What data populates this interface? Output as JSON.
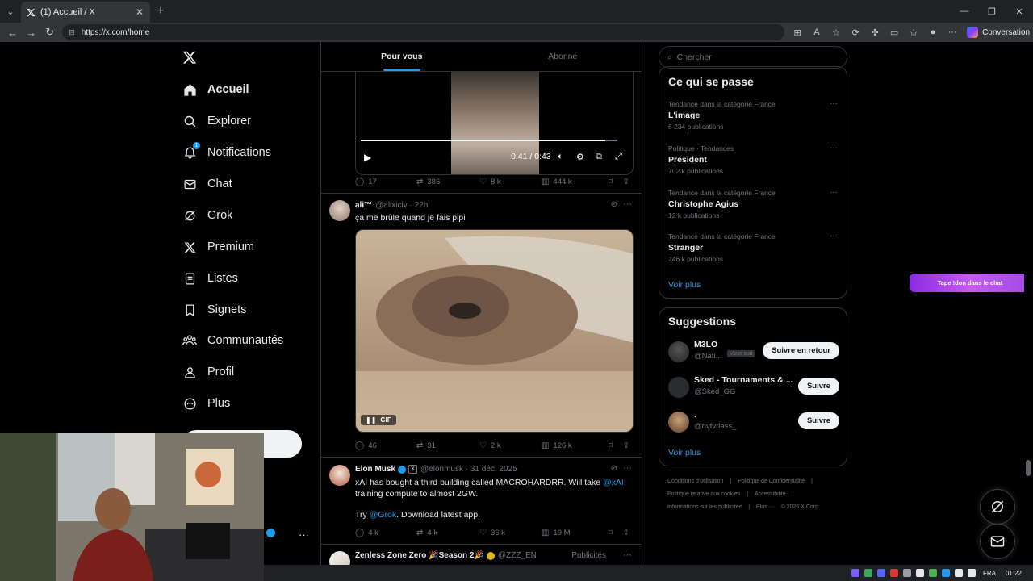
{
  "browser": {
    "tab_title": "(1) Accueil / X",
    "url": "https://x.com/home",
    "conversation_label": "Conversation"
  },
  "nav": {
    "items": [
      {
        "label": "Accueil",
        "icon": "home-icon"
      },
      {
        "label": "Explorer",
        "icon": "search-icon"
      },
      {
        "label": "Notifications",
        "icon": "bell-icon",
        "badge": "1"
      },
      {
        "label": "Chat",
        "icon": "mail-icon"
      },
      {
        "label": "Grok",
        "icon": "grok-icon"
      },
      {
        "label": "Premium",
        "icon": "x-icon"
      },
      {
        "label": "Listes",
        "icon": "list-icon"
      },
      {
        "label": "Signets",
        "icon": "bookmark-icon"
      },
      {
        "label": "Communautés",
        "icon": "people-icon"
      },
      {
        "label": "Profil",
        "icon": "user-icon"
      },
      {
        "label": "Plus",
        "icon": "more-circle-icon"
      }
    ]
  },
  "feed": {
    "tabs": [
      "Pour vous",
      "Abonné"
    ],
    "video_post": {
      "time": "0:41 / 0:43",
      "progress": 0.953,
      "replies": "17",
      "reposts": "386",
      "likes": "8 k",
      "views": "444 k"
    },
    "post1": {
      "name": "ali™",
      "handle": "@alixiciv · 22h",
      "text": "ça me brûle quand je fais pipi",
      "gif_label": "GIF",
      "replies": "46",
      "reposts": "31",
      "likes": "2 k",
      "views": "126 k"
    },
    "post2": {
      "name": "Elon Musk",
      "handle": "@elonmusk · 31 déc. 2025",
      "text1_a": "xAI has bought a third building called MACROHARDRR. Will take ",
      "text1_link": "@xAI",
      "text1_b": " training compute to almost 2GW.",
      "text2_a": "Try ",
      "text2_link": "@Grok",
      "text2_b": ". Download latest app.",
      "replies": "4 k",
      "reposts": "4 k",
      "likes": "36 k",
      "views": "19 M"
    },
    "post3": {
      "name": "Zenless Zone Zero 🎉Season 2🎉",
      "handle": "@ZZZ_EN",
      "ad_label": "Publicités"
    }
  },
  "right": {
    "search_placeholder": "Chercher",
    "trends_title": "Ce qui se passe",
    "trends": [
      {
        "context": "Tendance dans la catégorie France",
        "name": "L'image",
        "count": "6 234 publications"
      },
      {
        "context": "Politique · Tendances",
        "name": "Président",
        "count": "702 k publications"
      },
      {
        "context": "Tendance dans la catégorie France",
        "name": "Christophe Agius",
        "count": "12 k publications"
      },
      {
        "context": "Tendance dans la catégorie France",
        "name": "Stranger",
        "count": "246 k publications"
      }
    ],
    "see_more": "Voir plus",
    "suggestions_title": "Suggestions",
    "suggestions": [
      {
        "name": "M3LO",
        "handle": "@Nati...",
        "follows_you": "Vous suit",
        "button": "Suivre en retour"
      },
      {
        "name": "Sked - Tournaments & ...",
        "handle": "@Sked_GG",
        "button": "Suivre"
      },
      {
        "name": ".",
        "handle": "@nvfvrlass_",
        "button": "Suivre"
      }
    ],
    "footer": [
      "Conditions d'utilisation",
      "|",
      "Politique de Confidentialité",
      "|",
      "Politique relative aux cookies",
      "|",
      "Accessibilité",
      "|",
      "Informations sur les publicités",
      "|",
      "Plus ···",
      "© 2026 X Corp."
    ]
  },
  "overlay": {
    "chat_pill": "Tape !don dans le chat"
  },
  "taskbar": {
    "lang": "FRA",
    "time": "01:22"
  },
  "colors": {
    "accent": "#1d9bf0",
    "background": "#000000",
    "text": "#e7e9ea",
    "muted": "#71767b",
    "border": "#2f3336"
  }
}
